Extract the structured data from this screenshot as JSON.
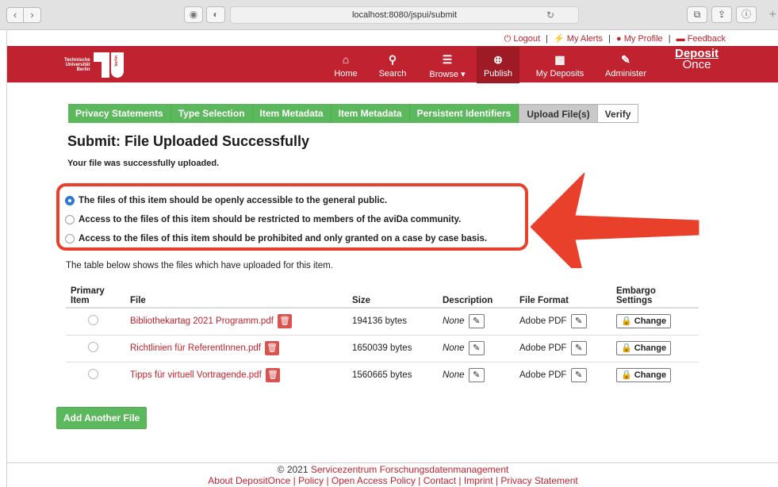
{
  "browser": {
    "url": "localhost:8080/jspui/submit",
    "back": "‹",
    "forward": "›"
  },
  "userbar": {
    "logout": "Logout",
    "alerts": "My Alerts",
    "profile": "My Profile",
    "feedback": "Feedback",
    "separator": "|"
  },
  "header": {
    "logo_text": [
      "Technische",
      "Universität",
      "Berlin"
    ],
    "logo_vertical": "berlin",
    "nav": [
      {
        "label": "Home",
        "icon": "home-icon",
        "glyph": "⌂"
      },
      {
        "label": "Search",
        "icon": "search-icon",
        "glyph": "⚲"
      },
      {
        "label": "Browse ▾",
        "icon": "list-icon",
        "glyph": "☰"
      },
      {
        "label": "Publish",
        "icon": "publish-icon",
        "glyph": "⊕"
      },
      {
        "label": "My Deposits",
        "icon": "grid-icon",
        "glyph": "▦"
      },
      {
        "label": "Administer",
        "icon": "wrench-icon",
        "glyph": "✎"
      }
    ],
    "brand_line1": "Deposit",
    "brand_line2": "Once"
  },
  "steps": [
    {
      "label": "Privacy Statements",
      "state": "done"
    },
    {
      "label": "Type Selection",
      "state": "done"
    },
    {
      "label": "Item Metadata",
      "state": "done"
    },
    {
      "label": "Item Metadata",
      "state": "done"
    },
    {
      "label": "Persistent Identifiers",
      "state": "done"
    },
    {
      "label": "Upload File(s)",
      "state": "current"
    },
    {
      "label": "Verify",
      "state": "todo"
    }
  ],
  "title": "Submit: File Uploaded Successfully",
  "subtitle": "Your file was successfully uploaded.",
  "access_options": [
    {
      "label": "The files of this item should be openly accessible to the general public.",
      "selected": true
    },
    {
      "label": "Access to the files of this item should be restricted to members of the aviDa community.",
      "selected": false
    },
    {
      "label": "Access to the files of this item should be prohibited and only granted on a case by case basis.",
      "selected": false
    }
  ],
  "table_note": "The table below shows the files which have uploaded for this item.",
  "table": {
    "headers": {
      "primary_line1": "Primary",
      "primary_line2": "Item",
      "file": "File",
      "size": "Size",
      "description": "Description",
      "format": "File Format",
      "embargo": "Embargo Settings"
    },
    "rows": [
      {
        "file": "Bibliothekartag 2021 Programm.pdf",
        "size": "194136 bytes",
        "description": "None",
        "format": "Adobe PDF",
        "embargo": "Change"
      },
      {
        "file": "Richtlinien für ReferentInnen.pdf",
        "size": "1650039 bytes",
        "description": "None",
        "format": "Adobe PDF",
        "embargo": "Change"
      },
      {
        "file": "Tipps für virtuell Vortragende.pdf",
        "size": "1560665 bytes",
        "description": "None",
        "format": "Adobe PDF",
        "embargo": "Change"
      }
    ]
  },
  "add_button": "Add Another File",
  "footer": {
    "copyright": "© 2021",
    "org": "Servicezentrum Forschungsdatenmanagement",
    "links": "About DepositOnce | Policy | Open Access Policy | Contact | Imprint | Privacy Statement"
  },
  "colors": {
    "brand_red": "#c0232f",
    "step_green": "#5cb85c",
    "highlight": "#e8402b",
    "radio_selected": "#2f7bd6"
  }
}
